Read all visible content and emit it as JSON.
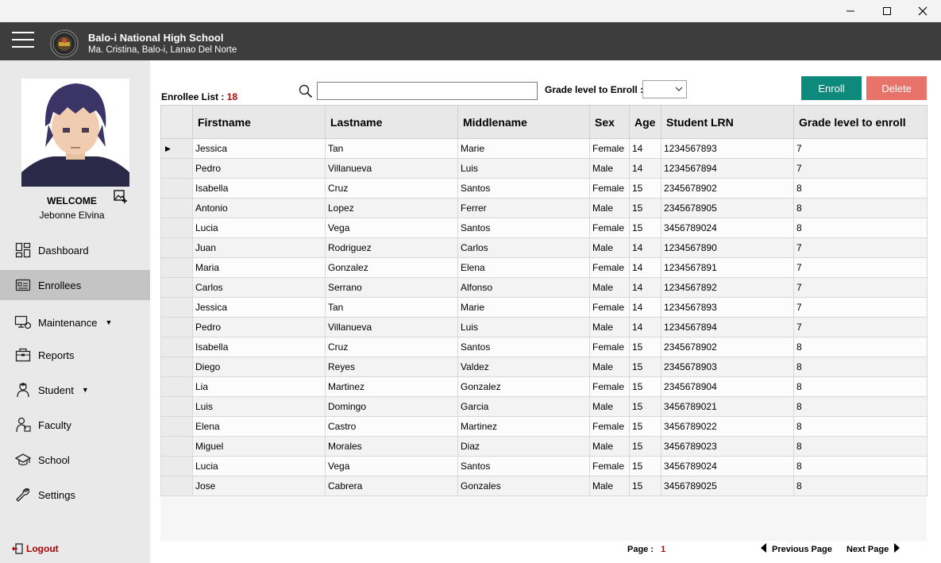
{
  "window": {
    "minimize_icon": "minimize-icon",
    "maximize_icon": "maximize-icon",
    "close_icon": "close-icon"
  },
  "header": {
    "school_name": "Balo-i National High School",
    "school_address": "Ma. Cristina, Balo-i, Lanao Del Norte",
    "background": "#3d3d3d"
  },
  "sidebar": {
    "welcome": "WELCOME",
    "user_name": "Jebonne Elvina",
    "items": [
      {
        "label": "Dashboard",
        "icon": "dashboard-icon",
        "active": false,
        "dropdown": false
      },
      {
        "label": "Enrollees",
        "icon": "enrollees-icon",
        "active": true,
        "dropdown": false
      },
      {
        "label": "Maintenance",
        "icon": "maintenance-icon",
        "active": false,
        "dropdown": true
      },
      {
        "label": "Reports",
        "icon": "reports-icon",
        "active": false,
        "dropdown": false
      },
      {
        "label": "Student",
        "icon": "student-icon",
        "active": false,
        "dropdown": true
      },
      {
        "label": "Faculty",
        "icon": "faculty-icon",
        "active": false,
        "dropdown": false
      },
      {
        "label": "School",
        "icon": "school-icon",
        "active": false,
        "dropdown": false
      },
      {
        "label": "Settings",
        "icon": "settings-icon",
        "active": false,
        "dropdown": false
      }
    ],
    "logout": "Logout",
    "active_color": "#c4c4c4"
  },
  "toolbar": {
    "enrollee_list_label": "Enrollee List :",
    "enrollee_count": "18",
    "search_value": "",
    "grade_label": "Grade level to Enroll :",
    "grade_value": "",
    "enroll_label": "Enroll",
    "delete_label": "Delete",
    "enroll_color": "#0d8a7b",
    "delete_color": "#e8736b"
  },
  "table": {
    "columns": [
      "Firstname",
      "Lastname",
      "Middlename",
      "Sex",
      "Age",
      "Student LRN",
      "Grade level to enroll"
    ],
    "rows": [
      [
        "Jessica",
        "Tan",
        "Marie",
        "Female",
        "14",
        "1234567893",
        "7"
      ],
      [
        "Pedro",
        "Villanueva",
        "Luis",
        "Male",
        "14",
        "1234567894",
        "7"
      ],
      [
        "Isabella",
        "Cruz",
        "Santos",
        "Female",
        "15",
        "2345678902",
        "8"
      ],
      [
        "Antonio",
        "Lopez",
        "Ferrer",
        "Male",
        "15",
        "2345678905",
        "8"
      ],
      [
        "Lucia",
        "Vega",
        "Santos",
        "Female",
        "15",
        "3456789024",
        "8"
      ],
      [
        "Juan",
        "Rodriguez",
        "Carlos",
        "Male",
        "14",
        "1234567890",
        "7"
      ],
      [
        "Maria",
        "Gonzalez",
        "Elena",
        "Female",
        "14",
        "1234567891",
        "7"
      ],
      [
        "Carlos",
        "Serrano",
        "Alfonso",
        "Male",
        "14",
        "1234567892",
        "7"
      ],
      [
        "Jessica",
        "Tan",
        "Marie",
        "Female",
        "14",
        "1234567893",
        "7"
      ],
      [
        "Pedro",
        "Villanueva",
        "Luis",
        "Male",
        "14",
        "1234567894",
        "7"
      ],
      [
        "Isabella",
        "Cruz",
        "Santos",
        "Female",
        "15",
        "2345678902",
        "8"
      ],
      [
        "Diego",
        "Reyes",
        "Valdez",
        "Male",
        "15",
        "2345678903",
        "8"
      ],
      [
        "Lia",
        "Martinez",
        "Gonzalez",
        "Female",
        "15",
        "2345678904",
        "8"
      ],
      [
        "Luis",
        "Domingo",
        "Garcia",
        "Male",
        "15",
        "3456789021",
        "8"
      ],
      [
        "Elena",
        "Castro",
        "Martinez",
        "Female",
        "15",
        "3456789022",
        "8"
      ],
      [
        "Miguel",
        "Morales",
        "Diaz",
        "Male",
        "15",
        "3456789023",
        "8"
      ],
      [
        "Lucia",
        "Vega",
        "Santos",
        "Female",
        "15",
        "3456789024",
        "8"
      ],
      [
        "Jose",
        "Cabrera",
        "Gonzales",
        "Male",
        "15",
        "3456789025",
        "8"
      ]
    ]
  },
  "footer": {
    "page_label": "Page :",
    "page_number": "1",
    "previous_label": "Previous Page",
    "next_label": "Next Page"
  }
}
